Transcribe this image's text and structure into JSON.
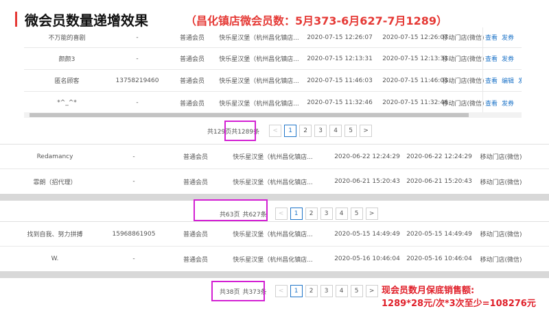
{
  "header": {
    "title": "微会员数量递增效果",
    "subtitle": "（昌化镇店微会员数：5月373-6月627-7月1289）"
  },
  "panel_july": {
    "rows": [
      {
        "name": "不万能的喜剧",
        "phone": "-",
        "level": "普通会员",
        "store": "快乐星汉堡（杭州昌化镇店...",
        "created": "2020-07-15 12:26:07",
        "updated": "2020-07-15 12:26:07",
        "source": "移动门店(微信)",
        "actions": [
          "查看",
          "发券"
        ]
      },
      {
        "name": "颜颜3",
        "phone": "-",
        "level": "普通会员",
        "store": "快乐星汉堡（杭州昌化镇店...",
        "created": "2020-07-15 12:13:31",
        "updated": "2020-07-15 12:13:31",
        "source": "移动门店(微信)",
        "actions": [
          "查看",
          "发券"
        ]
      },
      {
        "name": "匿名顾客",
        "phone": "13758219460",
        "level": "普通会员",
        "store": "快乐星汉堡（杭州昌化镇店...",
        "created": "2020-07-15 11:46:03",
        "updated": "2020-07-15 11:46:03",
        "source": "移动门店(微信)",
        "actions": [
          "查看",
          "编辑",
          "发券"
        ]
      },
      {
        "name": "*^_^*",
        "phone": "-",
        "level": "普通会员",
        "store": "快乐星汉堡（杭州昌化镇店...",
        "created": "2020-07-15 11:32:46",
        "updated": "2020-07-15 11:32:46",
        "source": "移动门店(微信)",
        "actions": [
          "查看",
          "发券"
        ]
      }
    ],
    "pager": {
      "pages": "共129页",
      "total": "共1289条",
      "prev": "<",
      "next": ">",
      "page_buttons": [
        "1",
        "2",
        "3",
        "4",
        "5"
      ]
    }
  },
  "panel_june": {
    "rows": [
      {
        "name": "Redamancy",
        "phone": "-",
        "level": "普通会员",
        "store": "快乐星汉堡（杭州昌化镇店...",
        "created": "2020-06-22 12:24:29",
        "updated": "2020-06-22 12:24:29",
        "source": "移动门店(微信)"
      },
      {
        "name": "霏朗（招代理）",
        "phone": "-",
        "level": "普通会员",
        "store": "快乐星汉堡（杭州昌化镇店...",
        "created": "2020-06-21 15:20:43",
        "updated": "2020-06-21 15:20:43",
        "source": "移动门店(微信)"
      }
    ],
    "pager": {
      "pages": "共63页",
      "total": "共627条",
      "prev": "<",
      "next": ">",
      "page_buttons": [
        "1",
        "2",
        "3",
        "4",
        "5"
      ]
    }
  },
  "panel_may": {
    "rows": [
      {
        "name": "找到自我、努力拼搏",
        "phone": "15968861905",
        "level": "普通会员",
        "store": "快乐星汉堡（杭州昌化镇店...",
        "created": "2020-05-15 14:49:49",
        "updated": "2020-05-15 14:49:49",
        "source": "移动门店(微信)"
      },
      {
        "name": "W.",
        "phone": "-",
        "level": "普通会员",
        "store": "快乐星汉堡（杭州昌化镇店...",
        "created": "2020-05-16 10:46:04",
        "updated": "2020-05-16 10:46:04",
        "source": "移动门店(微信)"
      }
    ],
    "pager": {
      "pages": "共38页",
      "total": "共373条",
      "prev": "<",
      "next": ">",
      "page_buttons": [
        "1",
        "2",
        "3",
        "4",
        "5"
      ]
    }
  },
  "sales_note": {
    "line1": "现会员数月保底销售额:",
    "line2": "1289*28元/次*3次至少=108276元"
  },
  "colors": {
    "accent": "#e53935",
    "highlight_box": "#d31fd3",
    "link": "#1e74c8",
    "note": "#e0202a"
  }
}
